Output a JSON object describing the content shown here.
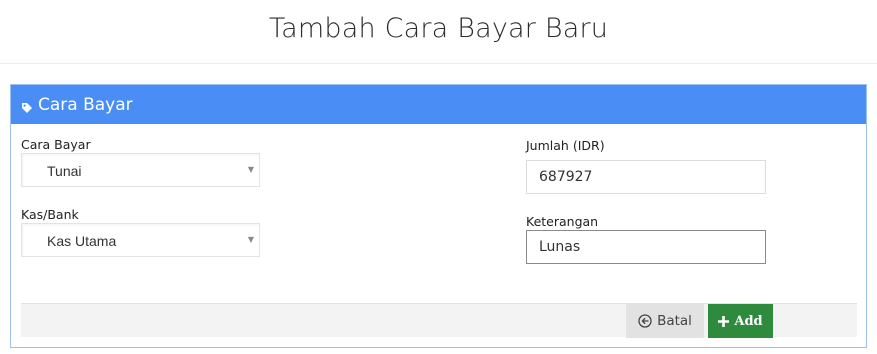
{
  "header": {
    "title": "Tambah Cara Bayar Baru"
  },
  "panel": {
    "title": "Cara Bayar",
    "icon": "tag-icon",
    "accent_color": "#4a8ef5"
  },
  "form": {
    "cara_bayar": {
      "label": "Cara Bayar",
      "value": "Tunai"
    },
    "kas_bank": {
      "label": "Kas/Bank",
      "value": "Kas Utama"
    },
    "jumlah": {
      "label": "Jumlah (IDR)",
      "value": "687927"
    },
    "keterangan": {
      "label": "Keterangan",
      "value": "Lunas"
    }
  },
  "actions": {
    "cancel_label": "Batal",
    "cancel_icon": "arrow-left-circle-icon",
    "add_label": "Add",
    "add_icon": "plus-icon",
    "add_color": "#2e8b3d"
  }
}
